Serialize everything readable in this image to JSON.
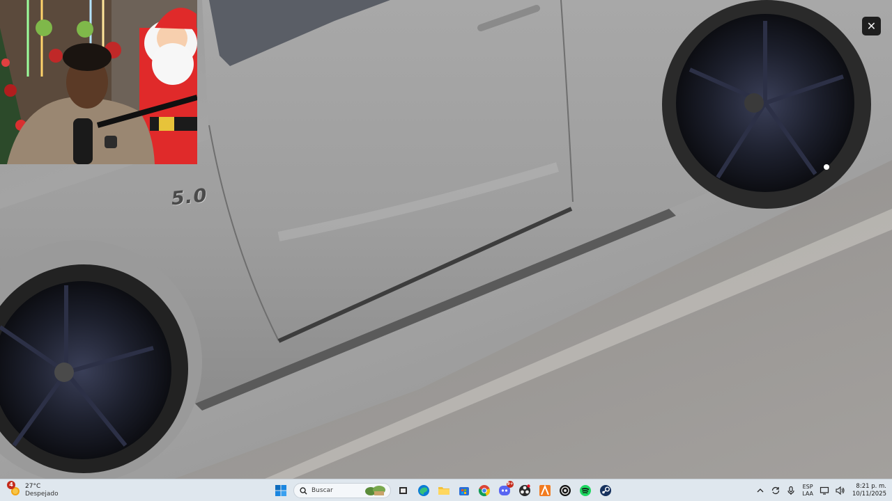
{
  "video": {
    "badge_text": "5.0",
    "close_label": "✕"
  },
  "taskbar": {
    "weather": {
      "temperature": "27°C",
      "condition": "Despejado",
      "badge": "4"
    },
    "search": {
      "placeholder": "Buscar"
    },
    "apps": [
      {
        "name": "start-button"
      },
      {
        "name": "file-explorer"
      },
      {
        "name": "edge"
      },
      {
        "name": "folder"
      },
      {
        "name": "store"
      },
      {
        "name": "chrome"
      },
      {
        "name": "discord",
        "badge": "9+"
      },
      {
        "name": "obs"
      },
      {
        "name": "app-orange"
      },
      {
        "name": "app-dark"
      },
      {
        "name": "spotify"
      },
      {
        "name": "steam"
      }
    ],
    "tray": {
      "language_top": "ESP",
      "language_bottom": "LAA",
      "time": "8:21 p. m.",
      "date": "10/11/2025"
    }
  },
  "colors": {
    "taskbar_bg": "#dfe7ee",
    "car_body": "#a5a5a5",
    "wheel": "#15161c",
    "badge_red": "#c42b1c"
  }
}
